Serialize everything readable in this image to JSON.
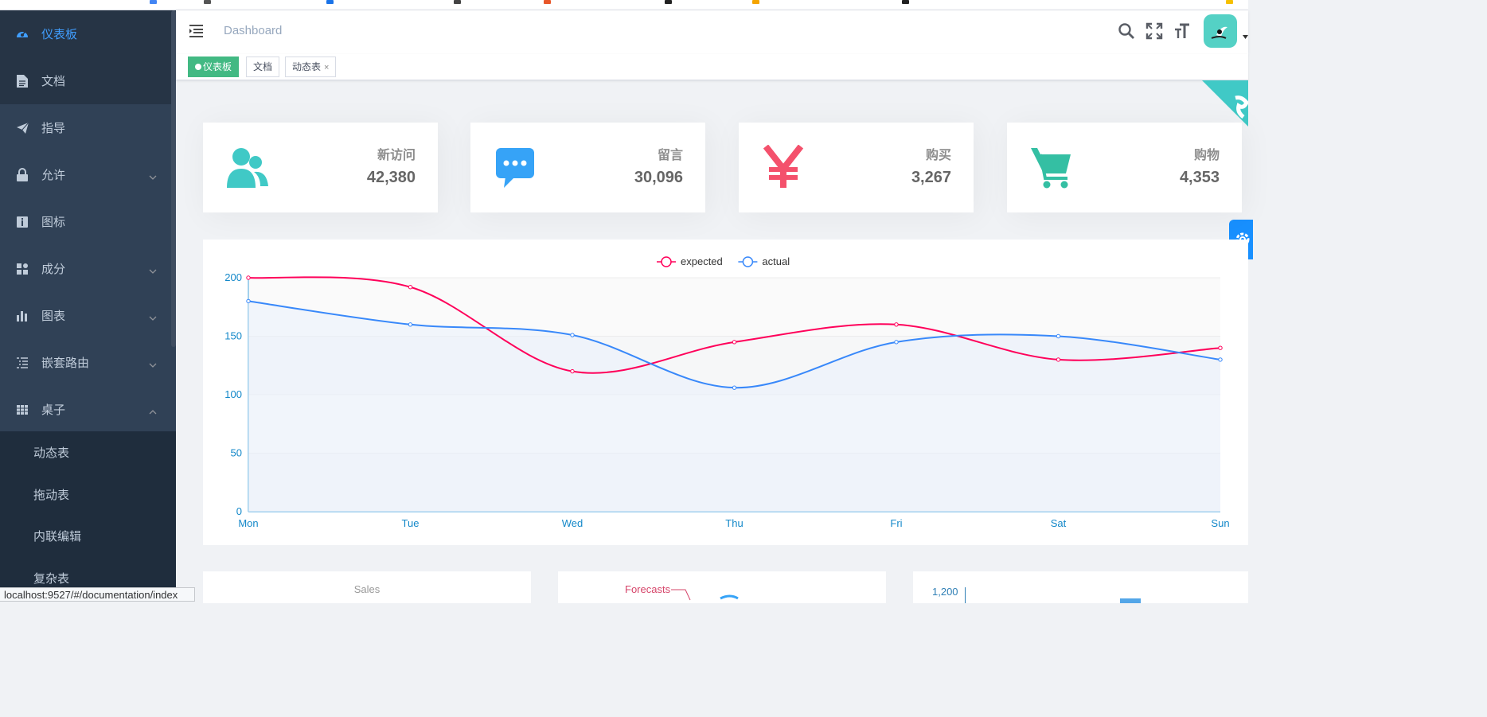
{
  "sidebar": {
    "items": [
      {
        "label": "仪表板",
        "icon": "dashboard-icon",
        "active": true
      },
      {
        "label": "文档",
        "icon": "document-icon"
      },
      {
        "label": "指导",
        "icon": "guide-icon"
      },
      {
        "label": "允许",
        "icon": "lock-icon",
        "expandable": true
      },
      {
        "label": "图标",
        "icon": "info-icon"
      },
      {
        "label": "成分",
        "icon": "component-icon",
        "expandable": true
      },
      {
        "label": "图表",
        "icon": "chart-icon",
        "expandable": true
      },
      {
        "label": "嵌套路由",
        "icon": "nested-icon",
        "expandable": true
      },
      {
        "label": "桌子",
        "icon": "table-icon",
        "expandable": true,
        "expanded": true
      }
    ],
    "subitems": [
      {
        "label": "动态表"
      },
      {
        "label": "拖动表"
      },
      {
        "label": "内联编辑"
      },
      {
        "label": "复杂表"
      }
    ]
  },
  "navbar": {
    "breadcrumb": "Dashboard",
    "icons": [
      "search-icon",
      "fullscreen-icon",
      "font-size-icon"
    ]
  },
  "tags": [
    {
      "label": "仪表板",
      "active": true
    },
    {
      "label": "文档"
    },
    {
      "label": "动态表",
      "closable": true,
      "close_glyph": "×"
    }
  ],
  "cards": [
    {
      "title": "新访问",
      "value": "42,380",
      "icon": "people-icon",
      "color": "#40c9c6"
    },
    {
      "title": "留言",
      "value": "30,096",
      "icon": "message-icon",
      "color": "#36a3f7"
    },
    {
      "title": "购买",
      "value": "3,267",
      "icon": "money-icon",
      "color": "#f4516c"
    },
    {
      "title": "购物",
      "value": "4,353",
      "icon": "shopping-icon",
      "color": "#34bfa3"
    }
  ],
  "chart_data": {
    "type": "line",
    "categories": [
      "Mon",
      "Tue",
      "Wed",
      "Thu",
      "Fri",
      "Sat",
      "Sun"
    ],
    "series": [
      {
        "name": "expected",
        "values": [
          200,
          192,
          120,
          145,
          160,
          130,
          140
        ],
        "color": "#ff005a"
      },
      {
        "name": "actual",
        "values": [
          180,
          160,
          151,
          106,
          145,
          150,
          130
        ],
        "color": "#3888fa"
      }
    ],
    "ylim": [
      0,
      200
    ],
    "yticks": [
      0,
      50,
      100,
      150,
      200
    ],
    "legend": "top-center",
    "smooth": true
  },
  "bottom_panels": [
    {
      "title": "Sales"
    },
    {
      "title": "Forecasts"
    },
    {
      "title": "",
      "tick": "1,200"
    }
  ],
  "statusbar": {
    "url": "localhost:9527/#/documentation/index"
  }
}
